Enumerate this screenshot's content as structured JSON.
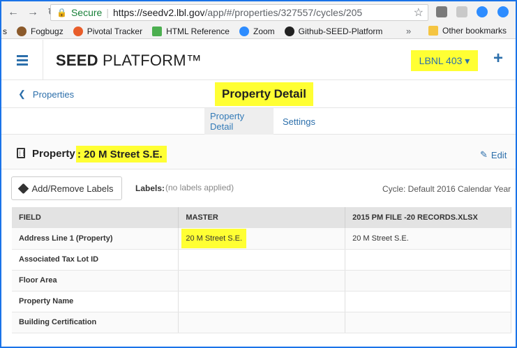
{
  "browser": {
    "secure_label": "Secure",
    "url_host": "https://seedv2.lbl.gov",
    "url_path": "/app/#/properties/327557/cycles/205",
    "bookmarks": [
      {
        "label": "s"
      },
      {
        "label": "Fogbugz"
      },
      {
        "label": "Pivotal Tracker"
      },
      {
        "label": "HTML Reference"
      },
      {
        "label": "Zoom"
      },
      {
        "label": "Github-SEED-Platform"
      }
    ],
    "more_label": "»",
    "other_bookmarks": "Other bookmarks"
  },
  "header": {
    "brand_bold": "SEED",
    "brand_rest": " PLATFORM™",
    "org_selector": "LBNL 403 ▾",
    "add_symbol": "+"
  },
  "subheader": {
    "back_label": "Properties",
    "title": "Property Detail"
  },
  "tabs": [
    {
      "label": "Property Detail",
      "active": true
    },
    {
      "label": "Settings",
      "active": false
    }
  ],
  "property": {
    "label": "Property",
    "name": ": 20 M Street S.E.",
    "edit_label": "Edit"
  },
  "labels": {
    "button": "Add/Remove Labels",
    "caption": "Labels:",
    "value": "(no labels applied)",
    "cycle": "Cycle: Default 2016 Calendar Year"
  },
  "table": {
    "headers": [
      "FIELD",
      "MASTER",
      "2015 PM FILE -20 RECORDS.XLSX"
    ],
    "rows": [
      [
        "Address Line 1 (Property)",
        "20 M Street S.E.",
        "20 M Street S.E."
      ],
      [
        "Associated Tax Lot ID",
        "",
        ""
      ],
      [
        "Floor Area",
        "",
        ""
      ],
      [
        "Property Name",
        "",
        ""
      ],
      [
        "Building Certification",
        "",
        ""
      ]
    ]
  },
  "colors": {
    "accent": "#2c6fab",
    "highlight": "#ffff33"
  }
}
